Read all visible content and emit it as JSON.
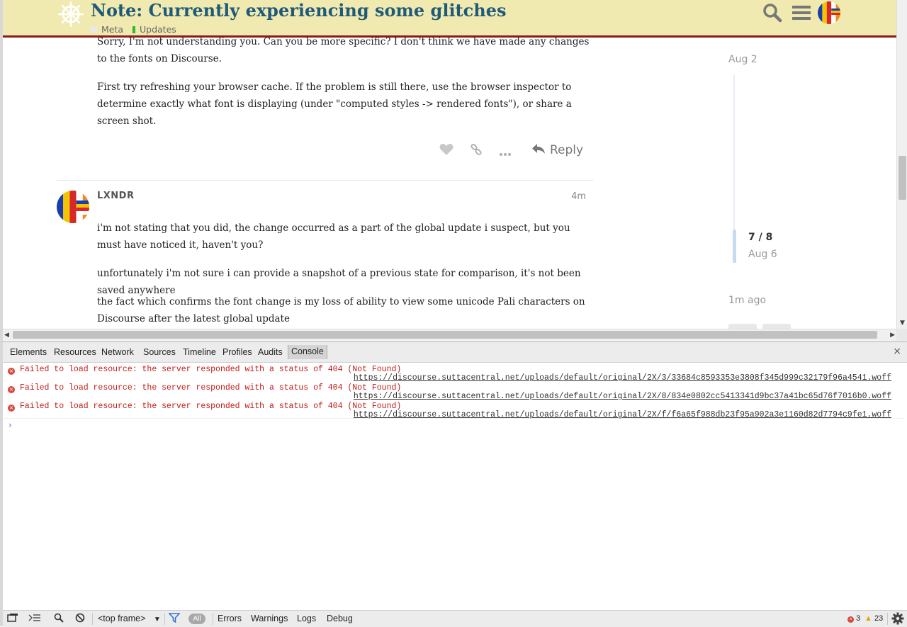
{
  "header": {
    "title": "Note: Currently experiencing some glitches",
    "categories": [
      {
        "name": "Meta",
        "color": "#e8e8e8"
      },
      {
        "name": "Updates",
        "color": "#2eb82e"
      }
    ]
  },
  "posts": {
    "previous": {
      "paragraphs": [
        "Sorry, I'm not understanding you. Can you be more specific? I don't think we have made any changes to the fonts on Discourse.",
        "First try refreshing your browser cache. If the problem is still there, use the browser inspector to determine exactly what font is displaying (under \"computed styles -> rendered fonts\"), or share a screen shot."
      ],
      "reply_label": "Reply"
    },
    "current": {
      "username": "LXNDR",
      "age": "4m",
      "paragraphs": [
        "i'm not stating that you did, the change occurred as a part of the global update i suspect, but you must have noticed it, haven't you?",
        "unfortunately i'm not sure i can provide a snapshot of a previous state for comparison, it's not been saved anywhere",
        "the fact which confirms the font change is my loss of ability to view some unicode Pali characters on Discourse after the latest global update"
      ]
    }
  },
  "timeline": {
    "start_date": "Aug 2",
    "position": "7 / 8",
    "position_date": "Aug 6",
    "last_activity": "1m ago"
  },
  "devtools": {
    "tabs": [
      "Elements",
      "Resources",
      "Network",
      "Sources",
      "Timeline",
      "Profiles",
      "Audits",
      "Console"
    ],
    "active_tab": "Console",
    "close_glyph": "×",
    "messages": [
      {
        "text": "Failed to load resource: the server responded with a status of 404 (Not Found)",
        "url": "https://discourse.suttacentral.net/uploads/default/original/2X/3/33684c8593353e3808f345d999c32179f96a4541.woff"
      },
      {
        "text": "Failed to load resource: the server responded with a status of 404 (Not Found)",
        "url": "https://discourse.suttacentral.net/uploads/default/original/2X/8/834e0802cc5413341d9bc37a41bc65d76f7016b0.woff"
      },
      {
        "text": "Failed to load resource: the server responded with a status of 404 (Not Found)",
        "url": "https://discourse.suttacentral.net/uploads/default/original/2X/f/f6a65f988db23f95a902a3e1160d82d7794c9fe1.woff"
      }
    ],
    "prompt_glyph": "›",
    "status_bar": {
      "frame_select": "<top frame>",
      "filter_all": "All",
      "filters": [
        "Errors",
        "Warnings",
        "Logs",
        "Debug"
      ],
      "error_count": "3",
      "warning_count": "23"
    }
  },
  "colors": {
    "header_bg": "#f0eab0",
    "header_border": "#8b1a1a",
    "title": "#1f5a7a",
    "error": "#c41a16"
  }
}
